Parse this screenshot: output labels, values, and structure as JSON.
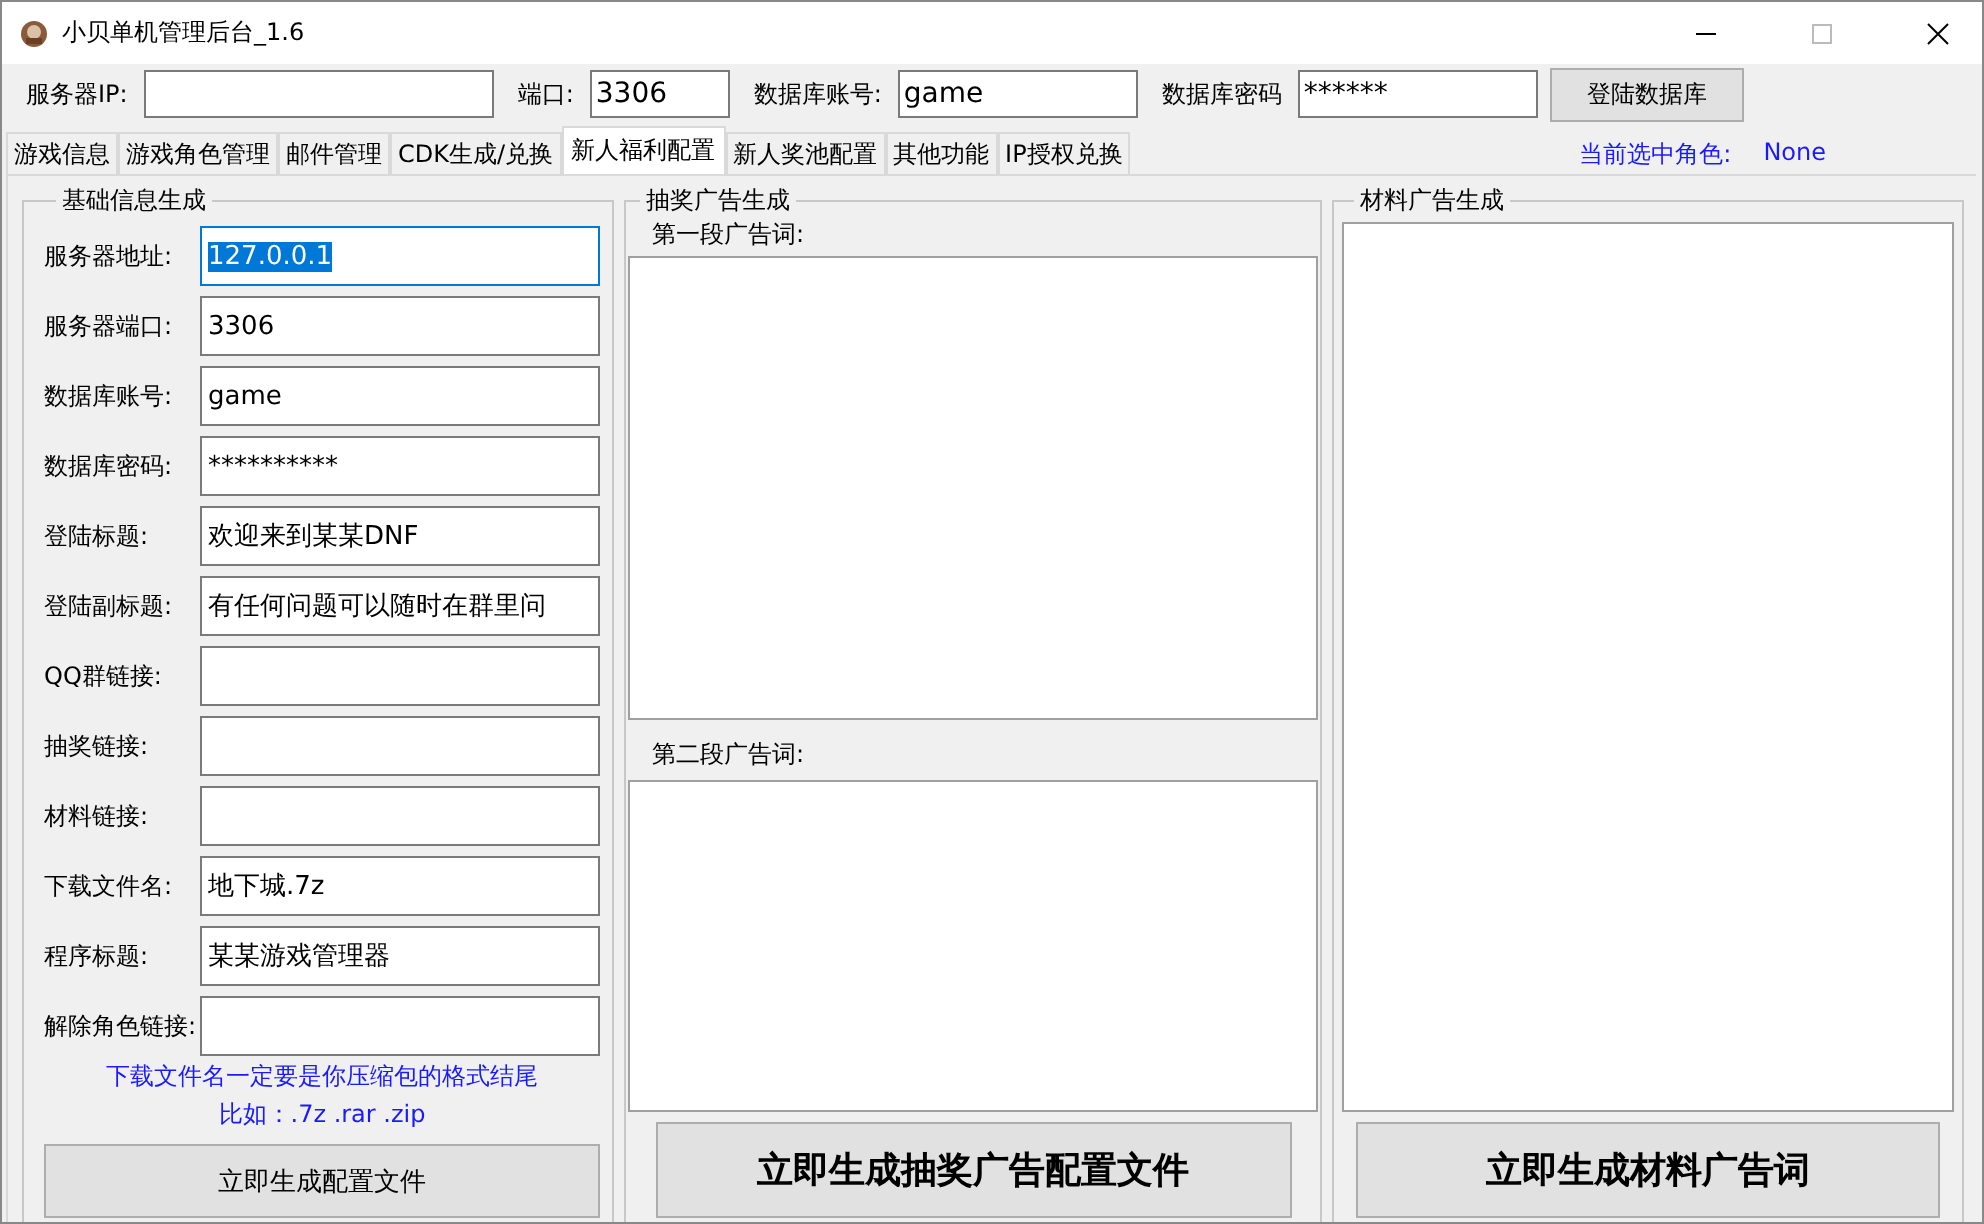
{
  "window": {
    "title": "小贝单机管理后台_1.6"
  },
  "connection": {
    "ip_label": "服务器IP:",
    "port_label": "端口:",
    "port_value": "3306",
    "account_label": "数据库账号:",
    "account_value": "game",
    "password_label": "数据库密码",
    "password_value": "******",
    "login_button": "登陆数据库"
  },
  "tabs": [
    {
      "label": "游戏信息",
      "selected": false
    },
    {
      "label": "游戏角色管理",
      "selected": false
    },
    {
      "label": "邮件管理",
      "selected": false
    },
    {
      "label": "CDK生成/兑换",
      "selected": false
    },
    {
      "label": "新人福利配置",
      "selected": true
    },
    {
      "label": "新人奖池配置",
      "selected": false
    },
    {
      "label": "其他功能",
      "selected": false
    },
    {
      "label": "IP授权兑换",
      "selected": false
    }
  ],
  "current_role": {
    "label": "当前选中角色:",
    "value": "None"
  },
  "basic_info": {
    "title": "基础信息生成",
    "fields": [
      {
        "label": "服务器地址:",
        "value": "127.0.0.1",
        "focused": true
      },
      {
        "label": "服务器端口:",
        "value": "3306",
        "focused": false
      },
      {
        "label": "数据库账号:",
        "value": "game",
        "focused": false
      },
      {
        "label": "数据库密码:",
        "value": "**********",
        "focused": false
      },
      {
        "label": "登陆标题:",
        "value": "欢迎来到某某DNF",
        "focused": false
      },
      {
        "label": "登陆副标题:",
        "value": "有任何问题可以随时在群里问",
        "focused": false
      },
      {
        "label": "QQ群链接:",
        "focused": false
      },
      {
        "label": "抽奖链接:",
        "focused": false
      },
      {
        "label": "材料链接:",
        "focused": false
      },
      {
        "label": "下载文件名:",
        "value": "地下城.7z",
        "focused": false
      },
      {
        "label": "程序标题:",
        "value": "某某游戏管理器",
        "focused": false
      },
      {
        "label": "解除角色链接:",
        "focused": false
      }
    ],
    "hints": [
      "下载文件名一定要是你压缩包的格式结尾",
      "比如：.7z .rar .zip"
    ],
    "button": "立即生成配置文件"
  },
  "lottery_ad": {
    "title": "抽奖广告生成",
    "first_label": "第一段广告词:",
    "second_label": "第二段广告词:",
    "button": "立即生成抽奖广告配置文件"
  },
  "material_ad": {
    "title": "材料广告生成",
    "button": "立即生成材料广告词"
  }
}
